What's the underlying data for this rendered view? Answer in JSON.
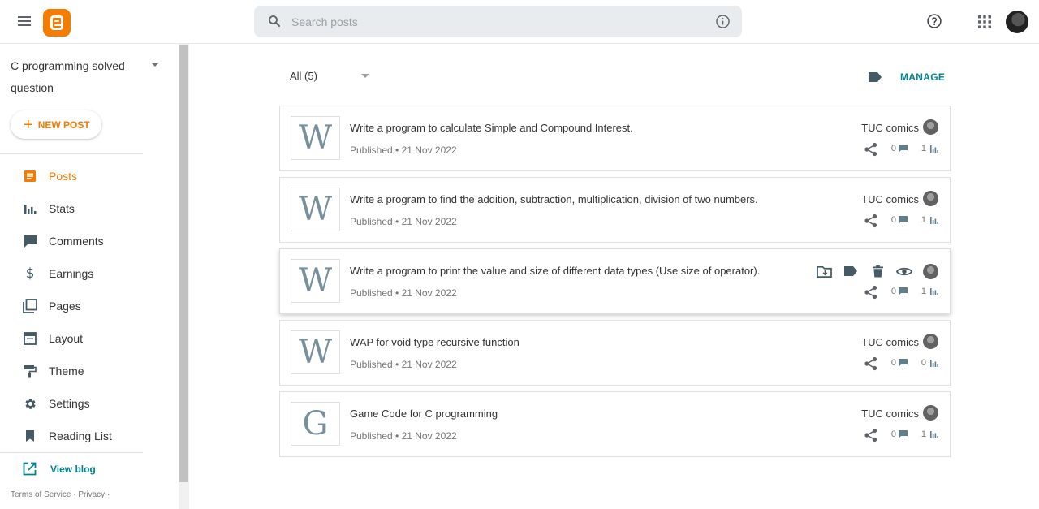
{
  "header": {
    "search_placeholder": "Search posts"
  },
  "sidebar": {
    "blog_title": "C programming solved question",
    "new_post_label": "NEW POST",
    "nav": [
      {
        "label": "Posts",
        "icon": "posts-icon",
        "active": true
      },
      {
        "label": "Stats",
        "icon": "stats-icon"
      },
      {
        "label": "Comments",
        "icon": "comment-icon"
      },
      {
        "label": "Earnings",
        "icon": "dollar-icon"
      },
      {
        "label": "Pages",
        "icon": "pages-icon"
      },
      {
        "label": "Layout",
        "icon": "layout-icon"
      },
      {
        "label": "Theme",
        "icon": "paint-roller-icon"
      },
      {
        "label": "Settings",
        "icon": "gear-icon"
      },
      {
        "label": "Reading List",
        "icon": "bookmark-icon"
      }
    ],
    "view_blog_label": "View blog",
    "footer": {
      "terms": "Terms of Service",
      "privacy": "Privacy"
    }
  },
  "main": {
    "filter_label": "All (5)",
    "manage_label": "MANAGE",
    "posts": [
      {
        "thumb": "W",
        "title": "Write a program to calculate Simple and Compound Interest.",
        "meta": "Published • 21 Nov 2022",
        "author": "TUC comics",
        "comments": "0",
        "views": "1"
      },
      {
        "thumb": "W",
        "title": "Write a program to find the addition, subtraction, multiplication, division of two numbers.",
        "meta": "Published • 21 Nov 2022",
        "author": "TUC comics",
        "comments": "0",
        "views": "1"
      },
      {
        "thumb": "W",
        "title": "Write a program to print the value and size of different data types (Use size of operator).",
        "meta": "Published • 21 Nov 2022",
        "author": "",
        "comments": "0",
        "views": "1",
        "hovered": true
      },
      {
        "thumb": "W",
        "title": "WAP for void type recursive function",
        "meta": "Published • 21 Nov 2022",
        "author": "TUC comics",
        "comments": "0",
        "views": "0"
      },
      {
        "thumb": "G",
        "title": "Game Code for C programming",
        "meta": "Published • 21 Nov 2022",
        "author": "TUC comics",
        "comments": "0",
        "views": "1"
      }
    ]
  },
  "colors": {
    "accent": "#f57c00",
    "link": "#00838f"
  }
}
